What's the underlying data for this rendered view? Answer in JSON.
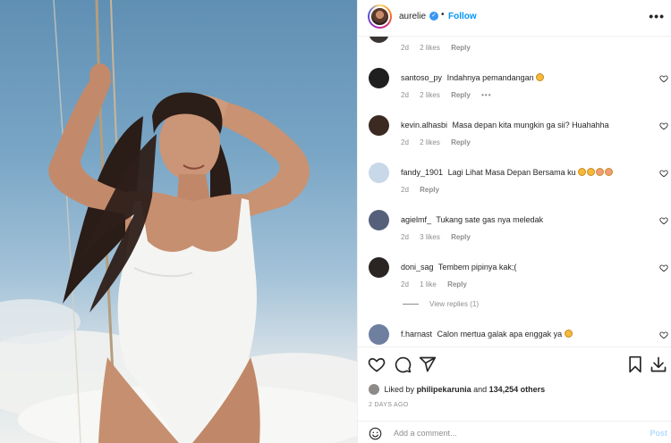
{
  "post": {
    "username": "aurelie",
    "verified_icon": "verified-badge-icon",
    "separator": "•",
    "follow_label": "Follow",
    "more_label": "•••"
  },
  "comments": [
    {
      "user": "",
      "text": "",
      "age": "2d",
      "likes": "2 likes",
      "reply": "Reply",
      "avatar_color": "#3a3330"
    },
    {
      "user": "santoso_py",
      "text": "Indahnya pemandangan",
      "emojis": 1,
      "age": "2d",
      "likes": "2 likes",
      "reply": "Reply",
      "extra": "•••",
      "avatar_color": "#1f1f1f"
    },
    {
      "user": "kevin.alhasbi",
      "text": "Masa depan kita mungkin ga sii? Huahahha",
      "age": "2d",
      "likes": "2 likes",
      "reply": "Reply",
      "avatar_color": "#3b2a22"
    },
    {
      "user": "fandy_1901",
      "text": "Lagi Lihat Masa Depan Bersama ku",
      "emojis": 4,
      "age": "2d",
      "likes": "",
      "reply": "Reply",
      "avatar_color": "#c8d8e8"
    },
    {
      "user": "agielmf_",
      "text": "Tukang sate gas nya meledak",
      "age": "2d",
      "likes": "3 likes",
      "reply": "Reply",
      "avatar_color": "#56607a"
    },
    {
      "user": "doni_sag",
      "text": "Tembem pipinya kak;(",
      "age": "2d",
      "likes": "1 like",
      "reply": "Reply",
      "avatar_color": "#2a2522"
    },
    {
      "user": "f.harnast",
      "text": "Calon mertua galak apa enggak ya",
      "emojis": 1,
      "age": "",
      "likes": "",
      "reply": "",
      "avatar_color": "#6f7fa0"
    }
  ],
  "view_replies": "View replies (1)",
  "actions": {
    "like": "heart-icon",
    "comment": "comment-icon",
    "share": "share-icon",
    "save": "bookmark-icon",
    "download": "download-icon"
  },
  "likes": {
    "prefix": "Liked by",
    "user": "philipekarunia",
    "middle": "and",
    "count": "134,254 others"
  },
  "timestamp": "2 DAYS AGO",
  "add_comment": {
    "placeholder": "Add a comment...",
    "post_label": "Post"
  }
}
